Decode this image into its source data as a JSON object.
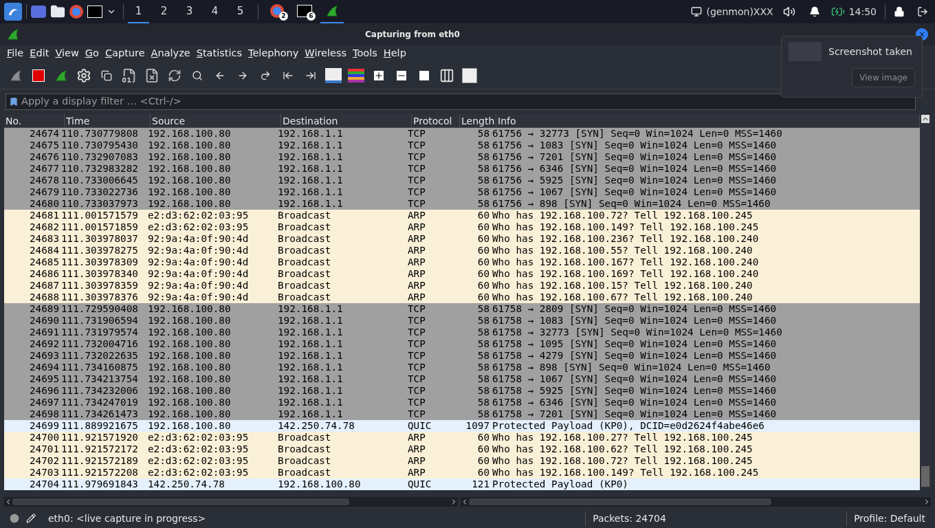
{
  "taskbar": {
    "workspaces": [
      {
        "label": "1",
        "selected": true
      },
      {
        "label": "2",
        "selected": false
      },
      {
        "label": "3",
        "selected": false
      },
      {
        "label": "4",
        "selected": false
      },
      {
        "label": "5",
        "selected": false
      }
    ],
    "apps": [
      {
        "kind": "browser",
        "badge": "2",
        "selected": false
      },
      {
        "kind": "terminal",
        "badge": "6",
        "selected": false
      },
      {
        "kind": "wireshark",
        "selected": true
      }
    ],
    "genmon": "(genmon)XXX",
    "clock": "14:50"
  },
  "window": {
    "title": "Capturing from eth0"
  },
  "menu": [
    "File",
    "Edit",
    "View",
    "Go",
    "Capture",
    "Analyze",
    "Statistics",
    "Telephony",
    "Wireless",
    "Tools",
    "Help"
  ],
  "filter": {
    "placeholder": "Apply a display filter … <Ctrl-/>"
  },
  "columns": [
    "No.",
    "Time",
    "Source",
    "Destination",
    "Protocol",
    "Length",
    "Info"
  ],
  "rows": [
    {
      "kind": "tcp",
      "no": "24674",
      "time": "110.730779808",
      "source": "192.168.100.80",
      "destination": "192.168.1.1",
      "protocol": "TCP",
      "length": "58",
      "info": "61756 → 32773 [SYN] Seq=0 Win=1024 Len=0 MSS=1460"
    },
    {
      "kind": "tcp",
      "no": "24675",
      "time": "110.730795430",
      "source": "192.168.100.80",
      "destination": "192.168.1.1",
      "protocol": "TCP",
      "length": "58",
      "info": "61756 → 1083 [SYN] Seq=0 Win=1024 Len=0 MSS=1460"
    },
    {
      "kind": "tcp",
      "no": "24676",
      "time": "110.732907083",
      "source": "192.168.100.80",
      "destination": "192.168.1.1",
      "protocol": "TCP",
      "length": "58",
      "info": "61756 → 7201 [SYN] Seq=0 Win=1024 Len=0 MSS=1460"
    },
    {
      "kind": "tcp",
      "no": "24677",
      "time": "110.732983282",
      "source": "192.168.100.80",
      "destination": "192.168.1.1",
      "protocol": "TCP",
      "length": "58",
      "info": "61756 → 6346 [SYN] Seq=0 Win=1024 Len=0 MSS=1460"
    },
    {
      "kind": "tcp",
      "no": "24678",
      "time": "110.733006645",
      "source": "192.168.100.80",
      "destination": "192.168.1.1",
      "protocol": "TCP",
      "length": "58",
      "info": "61756 → 5925 [SYN] Seq=0 Win=1024 Len=0 MSS=1460"
    },
    {
      "kind": "tcp",
      "no": "24679",
      "time": "110.733022736",
      "source": "192.168.100.80",
      "destination": "192.168.1.1",
      "protocol": "TCP",
      "length": "58",
      "info": "61756 → 1067 [SYN] Seq=0 Win=1024 Len=0 MSS=1460"
    },
    {
      "kind": "tcp",
      "no": "24680",
      "time": "110.733037973",
      "source": "192.168.100.80",
      "destination": "192.168.1.1",
      "protocol": "TCP",
      "length": "58",
      "info": "61756 → 898 [SYN] Seq=0 Win=1024 Len=0 MSS=1460"
    },
    {
      "kind": "arp",
      "no": "24681",
      "time": "111.001571579",
      "source": "e2:d3:62:02:03:95",
      "destination": "Broadcast",
      "protocol": "ARP",
      "length": "60",
      "info": "Who has 192.168.100.72? Tell 192.168.100.245"
    },
    {
      "kind": "arp",
      "no": "24682",
      "time": "111.001571859",
      "source": "e2:d3:62:02:03:95",
      "destination": "Broadcast",
      "protocol": "ARP",
      "length": "60",
      "info": "Who has 192.168.100.149? Tell 192.168.100.245"
    },
    {
      "kind": "arp",
      "no": "24683",
      "time": "111.303978037",
      "source": "92:9a:4a:0f:90:4d",
      "destination": "Broadcast",
      "protocol": "ARP",
      "length": "60",
      "info": "Who has 192.168.100.236? Tell 192.168.100.240"
    },
    {
      "kind": "arp",
      "no": "24684",
      "time": "111.303978275",
      "source": "92:9a:4a:0f:90:4d",
      "destination": "Broadcast",
      "protocol": "ARP",
      "length": "60",
      "info": "Who has 192.168.100.55? Tell 192.168.100.240"
    },
    {
      "kind": "arp",
      "no": "24685",
      "time": "111.303978309",
      "source": "92:9a:4a:0f:90:4d",
      "destination": "Broadcast",
      "protocol": "ARP",
      "length": "60",
      "info": "Who has 192.168.100.167? Tell 192.168.100.240"
    },
    {
      "kind": "arp",
      "no": "24686",
      "time": "111.303978340",
      "source": "92:9a:4a:0f:90:4d",
      "destination": "Broadcast",
      "protocol": "ARP",
      "length": "60",
      "info": "Who has 192.168.100.169? Tell 192.168.100.240"
    },
    {
      "kind": "arp",
      "no": "24687",
      "time": "111.303978359",
      "source": "92:9a:4a:0f:90:4d",
      "destination": "Broadcast",
      "protocol": "ARP",
      "length": "60",
      "info": "Who has 192.168.100.15? Tell 192.168.100.240"
    },
    {
      "kind": "arp",
      "no": "24688",
      "time": "111.303978376",
      "source": "92:9a:4a:0f:90:4d",
      "destination": "Broadcast",
      "protocol": "ARP",
      "length": "60",
      "info": "Who has 192.168.100.67? Tell 192.168.100.240"
    },
    {
      "kind": "tcp",
      "no": "24689",
      "time": "111.729590408",
      "source": "192.168.100.80",
      "destination": "192.168.1.1",
      "protocol": "TCP",
      "length": "58",
      "info": "61758 → 2809 [SYN] Seq=0 Win=1024 Len=0 MSS=1460"
    },
    {
      "kind": "tcp",
      "no": "24690",
      "time": "111.731906594",
      "source": "192.168.100.80",
      "destination": "192.168.1.1",
      "protocol": "TCP",
      "length": "58",
      "info": "61758 → 1083 [SYN] Seq=0 Win=1024 Len=0 MSS=1460"
    },
    {
      "kind": "tcp",
      "no": "24691",
      "time": "111.731979574",
      "source": "192.168.100.80",
      "destination": "192.168.1.1",
      "protocol": "TCP",
      "length": "58",
      "info": "61758 → 32773 [SYN] Seq=0 Win=1024 Len=0 MSS=1460"
    },
    {
      "kind": "tcp",
      "no": "24692",
      "time": "111.732004716",
      "source": "192.168.100.80",
      "destination": "192.168.1.1",
      "protocol": "TCP",
      "length": "58",
      "info": "61758 → 1095 [SYN] Seq=0 Win=1024 Len=0 MSS=1460"
    },
    {
      "kind": "tcp",
      "no": "24693",
      "time": "111.732022635",
      "source": "192.168.100.80",
      "destination": "192.168.1.1",
      "protocol": "TCP",
      "length": "58",
      "info": "61758 → 4279 [SYN] Seq=0 Win=1024 Len=0 MSS=1460"
    },
    {
      "kind": "tcp",
      "no": "24694",
      "time": "111.734160875",
      "source": "192.168.100.80",
      "destination": "192.168.1.1",
      "protocol": "TCP",
      "length": "58",
      "info": "61758 → 898 [SYN] Seq=0 Win=1024 Len=0 MSS=1460"
    },
    {
      "kind": "tcp",
      "no": "24695",
      "time": "111.734213754",
      "source": "192.168.100.80",
      "destination": "192.168.1.1",
      "protocol": "TCP",
      "length": "58",
      "info": "61758 → 1067 [SYN] Seq=0 Win=1024 Len=0 MSS=1460"
    },
    {
      "kind": "tcp",
      "no": "24696",
      "time": "111.734232006",
      "source": "192.168.100.80",
      "destination": "192.168.1.1",
      "protocol": "TCP",
      "length": "58",
      "info": "61758 → 5925 [SYN] Seq=0 Win=1024 Len=0 MSS=1460"
    },
    {
      "kind": "tcp",
      "no": "24697",
      "time": "111.734247019",
      "source": "192.168.100.80",
      "destination": "192.168.1.1",
      "protocol": "TCP",
      "length": "58",
      "info": "61758 → 6346 [SYN] Seq=0 Win=1024 Len=0 MSS=1460"
    },
    {
      "kind": "tcp",
      "no": "24698",
      "time": "111.734261473",
      "source": "192.168.100.80",
      "destination": "192.168.1.1",
      "protocol": "TCP",
      "length": "58",
      "info": "61758 → 7201 [SYN] Seq=0 Win=1024 Len=0 MSS=1460"
    },
    {
      "kind": "quic",
      "no": "24699",
      "time": "111.889921675",
      "source": "192.168.100.80",
      "destination": "142.250.74.78",
      "protocol": "QUIC",
      "length": "1097",
      "info": "Protected Payload (KP0), DCID=e0d2624f4abe46e6"
    },
    {
      "kind": "arp",
      "no": "24700",
      "time": "111.921571920",
      "source": "e2:d3:62:02:03:95",
      "destination": "Broadcast",
      "protocol": "ARP",
      "length": "60",
      "info": "Who has 192.168.100.27? Tell 192.168.100.245"
    },
    {
      "kind": "arp",
      "no": "24701",
      "time": "111.921572172",
      "source": "e2:d3:62:02:03:95",
      "destination": "Broadcast",
      "protocol": "ARP",
      "length": "60",
      "info": "Who has 192.168.100.62? Tell 192.168.100.245"
    },
    {
      "kind": "arp",
      "no": "24702",
      "time": "111.921572189",
      "source": "e2:d3:62:02:03:95",
      "destination": "Broadcast",
      "protocol": "ARP",
      "length": "60",
      "info": "Who has 192.168.100.72? Tell 192.168.100.245"
    },
    {
      "kind": "arp",
      "no": "24703",
      "time": "111.921572208",
      "source": "e2:d3:62:02:03:95",
      "destination": "Broadcast",
      "protocol": "ARP",
      "length": "60",
      "info": "Who has 192.168.100.149? Tell 192.168.100.245"
    },
    {
      "kind": "quic",
      "no": "24704",
      "time": "111.979691843",
      "source": "142.250.74.78",
      "destination": "192.168.100.80",
      "protocol": "QUIC",
      "length": "121",
      "info": "Protected Payload (KP0)"
    }
  ],
  "status": {
    "interface": "eth0: <live capture in progress>",
    "packets": "Packets: 24704",
    "profile": "Profile: Default"
  },
  "notification": {
    "title": "Screenshot taken",
    "button": "View image"
  }
}
